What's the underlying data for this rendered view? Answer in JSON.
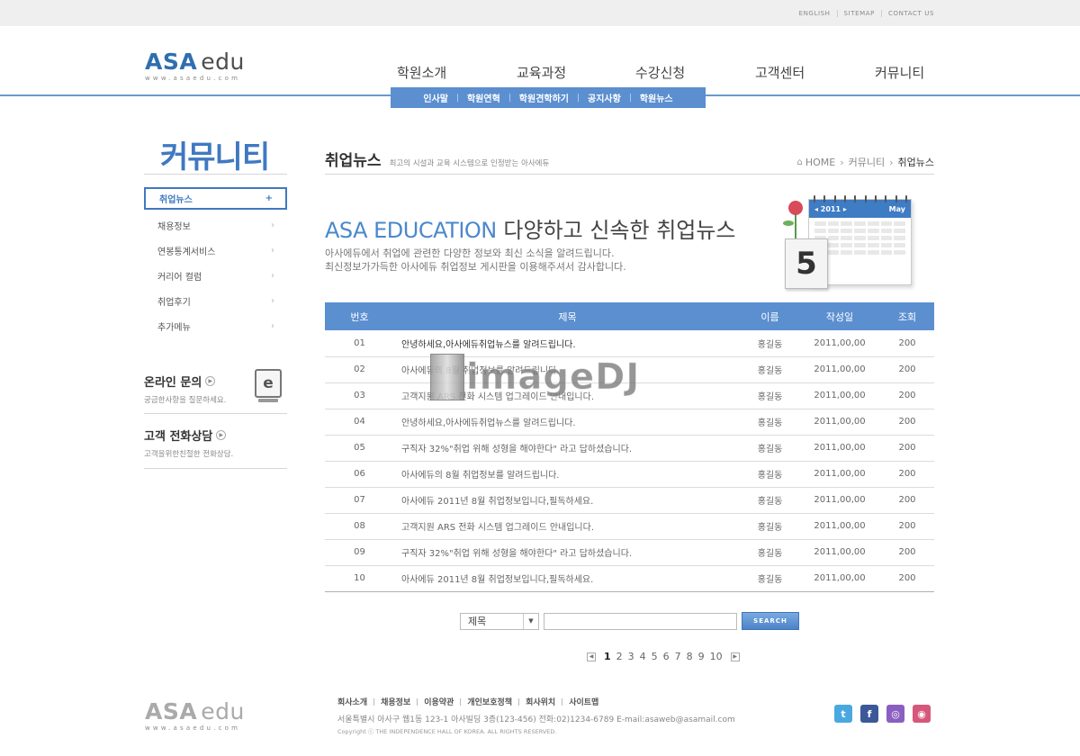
{
  "top_links": [
    "ENGLISH",
    "SITEMAP",
    "CONTACT US"
  ],
  "logo": {
    "main": "ASA",
    "sub": "edu",
    "url": "www.asaedu.com"
  },
  "gnb": [
    "학원소개",
    "교육과정",
    "수강신청",
    "고객센터",
    "커뮤니티"
  ],
  "subnav": [
    "인사말",
    "학원연혁",
    "학원견학하기",
    "공지사항",
    "학원뉴스"
  ],
  "sidebar": {
    "title": "커뮤니티",
    "items": [
      "취업뉴스",
      "채용정보",
      "연봉통계서비스",
      "커리어 컬럼",
      "취업후기",
      "추가메뉴"
    ],
    "active_arrow": "+",
    "arrow": "›",
    "online": {
      "title": "온라인 문의",
      "desc": "궁금한사항을 질문하세요.",
      "icon": "e"
    },
    "phone": {
      "title": "고객 전화상담",
      "desc": "고객을위한친절한 전화상담."
    }
  },
  "content": {
    "title": "취업뉴스",
    "desc": "최고의 시설과 교육 시스템으로 인정받는 아사에듀",
    "breadcrumb": {
      "home": "HOME",
      "section": "커뮤니티",
      "current": "취업뉴스"
    },
    "banner": {
      "head_en": "ASA EDUCATION",
      "head_ko": " 다양하고 신속한 취업뉴스",
      "line1": "아사에듀에서 취업에 관련한 다양한 정보와 최신 소식을 알려드립니다.",
      "line2": "최신정보가가득한 아사에듀 취업정보 게시판을 이용해주셔서 감사합니다.",
      "cal_year": "◂ 2011 ▸",
      "cal_month": "May",
      "cal_day": "5"
    }
  },
  "table": {
    "headers": [
      "번호",
      "제목",
      "이름",
      "작성일",
      "조회"
    ],
    "rows": [
      [
        "01",
        "안녕하세요,아사에듀취업뉴스를 알려드립니다.",
        "홍길동",
        "2011,00,00",
        "200"
      ],
      [
        "02",
        "아사에듀의  8월 취업정보를 알려드립니다.",
        "홍길동",
        "2011,00,00",
        "200"
      ],
      [
        "03",
        "고객지원 ARS 전화 시스템 업그레이드 안내입니다.",
        "홍길동",
        "2011,00,00",
        "200"
      ],
      [
        "04",
        "안녕하세요,아사에듀취업뉴스를 알려드립니다.",
        "홍길동",
        "2011,00,00",
        "200"
      ],
      [
        "05",
        "구직자 32%\"취업 위해 성형을 해야한다\" 라고 답하셨습니다.",
        "홍길동",
        "2011,00,00",
        "200"
      ],
      [
        "06",
        "아사에듀의  8월 취업정보를 알려드립니다.",
        "홍길동",
        "2011,00,00",
        "200"
      ],
      [
        "07",
        "아사에듀 2011년 8월 취업정보입니다,필독하세요.",
        "홍길동",
        "2011,00,00",
        "200"
      ],
      [
        "08",
        "고객지원 ARS 전화 시스템 업그레이드 안내입니다.",
        "홍길동",
        "2011,00,00",
        "200"
      ],
      [
        "09",
        "구직자 32%\"취업 위해 성형을 해야한다\" 라고 답하셨습니다.",
        "홍길동",
        "2011,00,00",
        "200"
      ],
      [
        "10",
        "아사에듀 2011년 8월 취업정보입니다,필독하세요.",
        "홍길동",
        "2011,00,00",
        "200"
      ]
    ]
  },
  "watermark": "imageDJ",
  "search": {
    "select_value": "제목",
    "input_value": "",
    "button": "SEARCH"
  },
  "paging": {
    "pages": [
      "1",
      "2",
      "3",
      "4",
      "5",
      "6",
      "7",
      "8",
      "9",
      "10"
    ],
    "current": "1"
  },
  "footer": {
    "links": [
      "회사소개",
      "채용정보",
      "이용약관",
      "개인보호정책",
      "회사위치",
      "사이트맵"
    ],
    "address": "서울특별시 아사구 웹1동 123-1 아사빌딩 3층(123-456) 전화:02)1234-6789 E-mail:asaweb@asamail.com",
    "copyright": "Copyright ⓒ THE INDEPENDENCE HALL OF KOREA. ALL RIGHTS RESERVED.",
    "sns": [
      "twitter-icon",
      "facebook-icon",
      "messenger-icon",
      "instagram-icon"
    ]
  }
}
